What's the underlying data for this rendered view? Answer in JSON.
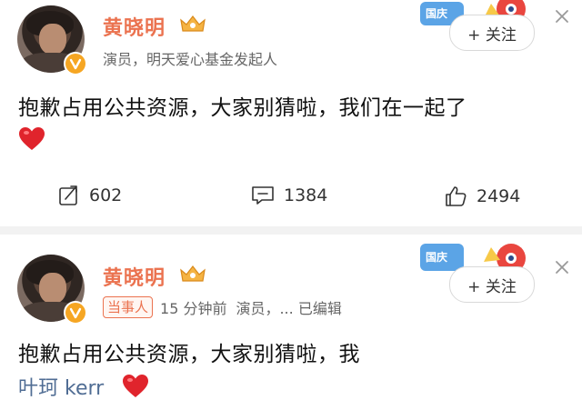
{
  "post_top": {
    "author": "黄晓明",
    "bio": "演员，明天爱心基金发起人",
    "follow_label": "+ 关注",
    "content": "抱歉占用公共资源，大家别猜啦，我们在一起了",
    "actions": {
      "share_count": "602",
      "comment_count": "1384",
      "like_count": "2494"
    }
  },
  "post_bottom": {
    "author": "黄晓明",
    "tag": "当事人",
    "time": "15 分钟前",
    "bio": "演员，... 已编辑",
    "follow_label": "+ 关注",
    "content": "抱歉占用公共资源，大家别猜啦，我",
    "mention": "叶珂 kerr"
  },
  "mascot_text": "国庆",
  "colors": {
    "accent": "#eb7350",
    "link": "#506d94",
    "heart": "#e0242c",
    "badge": "#f6a623"
  }
}
